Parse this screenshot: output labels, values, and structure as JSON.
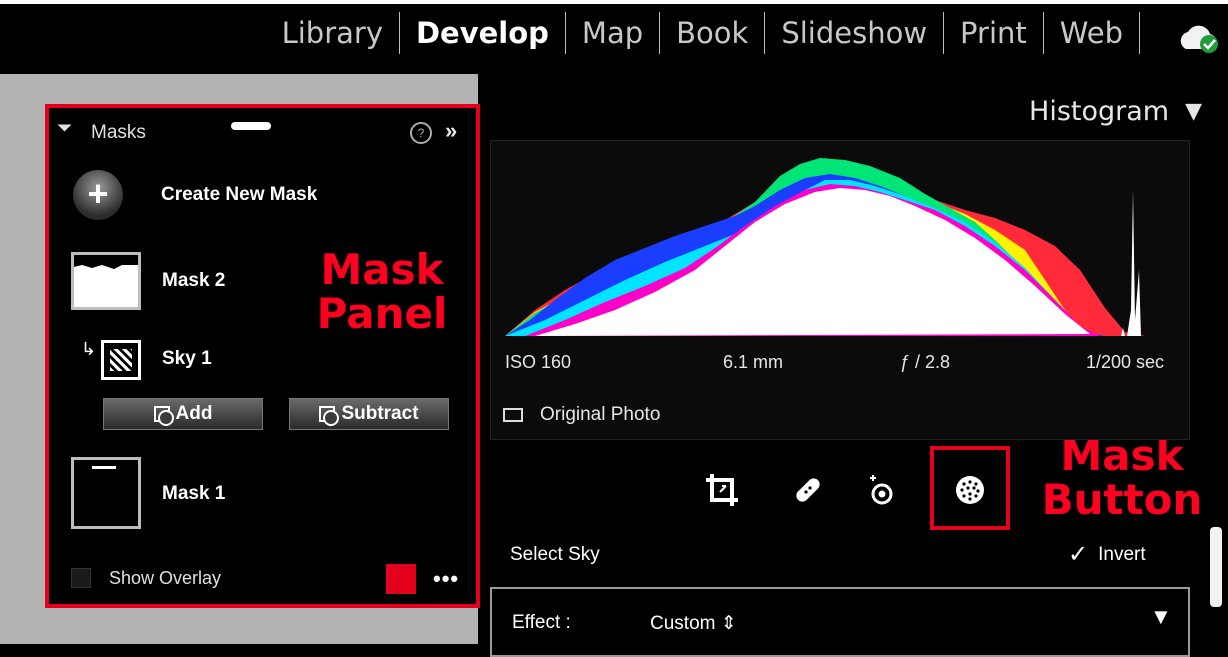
{
  "module_bar": {
    "modules": [
      "Library",
      "Develop",
      "Map",
      "Book",
      "Slideshow",
      "Print",
      "Web"
    ],
    "active": "Develop",
    "sync_icon": "cloud-check-icon"
  },
  "masks_panel": {
    "title": "Masks",
    "help_icon": "help-icon",
    "expand_icon": "double-chevron-icon",
    "expand_label": "»",
    "create_label": "Create New Mask",
    "mask2_label": "Mask 2",
    "sky1_label": "Sky 1",
    "add_label": "Add",
    "subtract_label": "Subtract",
    "mask1_label": "Mask 1",
    "show_overlay_label": "Show Overlay",
    "overlay_color": "#e4001d",
    "more_label": "•••"
  },
  "annotations": {
    "mask_panel_line1": "Mask",
    "mask_panel_line2": "Panel",
    "mask_button_line1": "Mask",
    "mask_button_line2": "Button",
    "highlight_color": "#e4001d"
  },
  "histogram": {
    "title": "Histogram",
    "collapse_glyph": "▼",
    "iso": "ISO 160",
    "focal_length": "6.1 mm",
    "aperture": "ƒ / 2.8",
    "shutter": "1/200 sec",
    "original_photo_label": "Original Photo"
  },
  "tools": [
    "crop-tool-icon",
    "healing-tool-icon",
    "red-eye-tool-icon",
    "masking-tool-icon"
  ],
  "mask_options": {
    "select_label": "Select Sky",
    "invert_check": "✓",
    "invert_label": "Invert",
    "effect_label": "Effect :",
    "effect_value": "Custom ⇕",
    "effect_menu_glyph": "▼"
  }
}
